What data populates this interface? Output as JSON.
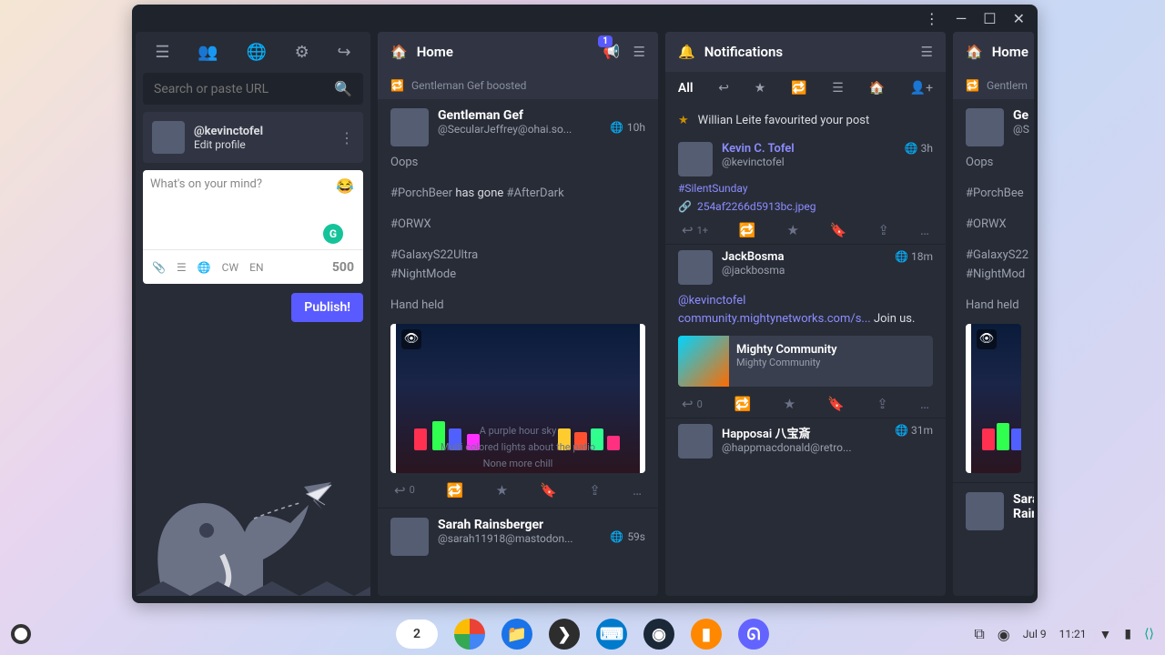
{
  "window": {
    "menu_dots": "⋮",
    "min": "—",
    "max": "☐",
    "close": "✕"
  },
  "sidebar": {
    "search_placeholder": "Search or paste URL",
    "handle": "@kevinctofel",
    "edit": "Edit profile",
    "compose_placeholder": "What's on your mind?",
    "cw": "CW",
    "lang": "EN",
    "char_count": "500",
    "publish": "Publish!"
  },
  "col1": {
    "title": "Home",
    "badge": "1",
    "boost": "Gentleman Gef boosted",
    "p1": {
      "name": "Gentleman Gef",
      "handle": "@SecularJeffrey@ohai.so...",
      "time": "10h",
      "l1": "Oops",
      "l2a": "#PorchBeer",
      "l2b": " has gone ",
      "l2c": "#AfterDark",
      "l3": "#ORWX",
      "l4": "#GalaxyS22Ultra",
      "l5": "#NightMode",
      "l6": "Hand held",
      "cap1": "A purple hour sky",
      "cap2": "Multi colored lights about the patio",
      "cap3": "None more chill",
      "reply_cnt": "0"
    },
    "p2": {
      "name": "Sarah Rainsberger",
      "handle": "@sarah11918@mastodon...",
      "time": "59s"
    }
  },
  "col2": {
    "title": "Notifications",
    "tab_all": "All",
    "fav_line": "Willian Leite favourited your post",
    "n1": {
      "name": "Kevin C. Tofel",
      "handle": "@kevinctofel",
      "time": "3h",
      "tag": "#SilentSunday",
      "attach": "254af2266d5913bc.jpeg",
      "reply_cnt": "1+"
    },
    "n2": {
      "name": "JackBosma",
      "handle": "@jackbosma",
      "time": "18m",
      "mention": "@kevinctofel",
      "link": "community.mightynetworks.com/s...",
      "tail": " Join us.",
      "card_title": "Mighty Community",
      "card_sub": "Mighty Community",
      "reply_cnt": "0"
    },
    "n3": {
      "name": "Happosai 八宝斎",
      "handle": "@happmacdonald@retro...",
      "time": "31m"
    }
  },
  "col3": {
    "title": "Home",
    "boost": "Gentlem",
    "name": "Ge",
    "handle": "@S",
    "l1": "Oops",
    "l2": "#PorchBee",
    "l3": "#ORWX",
    "l4": "#GalaxyS22",
    "l5": "#NightMod",
    "l6": "Hand held"
  },
  "taskbar": {
    "tabs": "2",
    "date": "Jul 9",
    "time": "11:21"
  }
}
